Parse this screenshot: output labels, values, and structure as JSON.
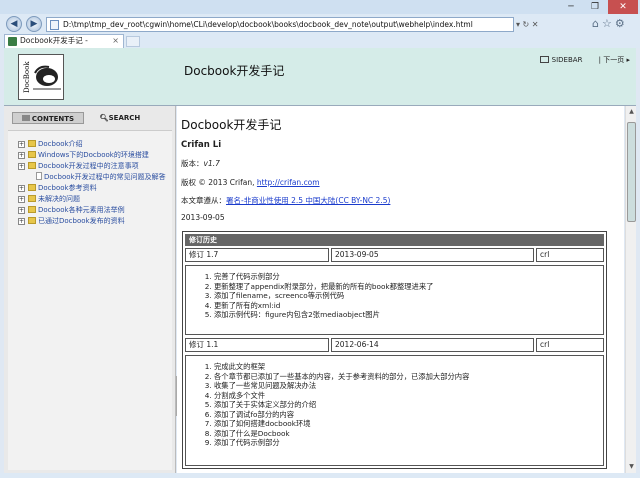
{
  "browser": {
    "url": "D:\\tmp\\tmp_dev_root\\cgwin\\home\\CLi\\develop\\docbook\\books\\docbook_dev_note\\output\\webhelp\\index.html",
    "tab_title": "Docbook开发手记 -",
    "back_icon": "back-arrow-icon",
    "forward_icon": "forward-arrow-icon",
    "caption_controls": [
      "─",
      "❐",
      "✕"
    ],
    "addr_controls": "▾ ↻ ✕",
    "toolbar_icons": "⌂☆⚙"
  },
  "header": {
    "site_title": "Docbook开发手记",
    "sidebar_label": "SIDEBAR",
    "next_label": "| 下一页 ▸"
  },
  "sidebar": {
    "tabs": [
      {
        "label": "CONTENTS",
        "active": true
      },
      {
        "label": "SEARCH",
        "active": false
      }
    ],
    "toc": [
      {
        "label": "Docbook介绍",
        "type": "folder"
      },
      {
        "label": "Windows下的Docbook的环境搭建",
        "type": "folder"
      },
      {
        "label": "Docbook开发过程中的注意事项",
        "type": "folder"
      },
      {
        "label": "Docbook开发过程中的常见问题及解答",
        "type": "doc"
      },
      {
        "label": "Docbook参考资料",
        "type": "folder"
      },
      {
        "label": "未解决的问题",
        "type": "folder"
      },
      {
        "label": "Docbook各种元素用法举例",
        "type": "folder"
      },
      {
        "label": "已通过Docbook发布的资料",
        "type": "folder"
      }
    ]
  },
  "content": {
    "title": "Docbook开发手记",
    "author": "Crifan Li",
    "version_label": "版本：",
    "version": "v1.7",
    "copyright_text": "版权 © 2013 Crifan,",
    "copyright_link": "http://crifan.com",
    "license_prefix": "本文章遵从：",
    "license_link": "署名-非商业性使用 2.5 中国大陆(CC BY-NC 2.5)",
    "date": "2013-09-05",
    "history_header": "修订历史",
    "revisions": [
      {
        "rev": "修订 1.7",
        "date": "2013-09-05",
        "author": "crl",
        "items": [
          "完善了代码示例部分",
          "更新整理了appendix附录部分，把最新的所有的book都整理进来了",
          "添加了filename，screenco等示例代码",
          "更新了所有的xml:id",
          "添加示例代码：figure内包含2张mediaobject图片"
        ]
      },
      {
        "rev": "修订 1.1",
        "date": "2012-06-14",
        "author": "crl",
        "items": [
          "完成此文的框架",
          "各个章节都已添加了一些基本的内容，关于参考资料的部分，已添加大部分内容",
          "收集了一些常见问题及解决办法",
          "分割成多个文件",
          "添加了关于实体定义部分的介绍",
          "添加了调试fo部分的内容",
          "添加了如何搭建docbook环境",
          "添加了什么是Docbook",
          "添加了代码示例部分"
        ]
      }
    ]
  }
}
